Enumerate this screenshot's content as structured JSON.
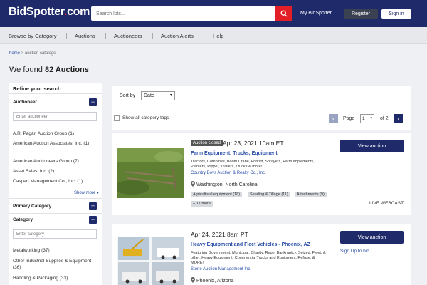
{
  "header": {
    "logo_main": "BidSpotter",
    "logo_dot": ".",
    "logo_tld": "com",
    "search_placeholder": "Search lots...",
    "my_account": "My BidSpotter",
    "register": "Register",
    "signin": "Sign in",
    "colors": {
      "brand": "#1f2a6b",
      "accent": "#e21f26"
    }
  },
  "nav": {
    "items": [
      "Browse by Category",
      "Auctions",
      "Auctioneers",
      "Auction Alerts",
      "Help"
    ]
  },
  "breadcrumb": {
    "home": "home",
    "sep": ">",
    "current": "auction catalogs"
  },
  "results": {
    "prefix": "We found",
    "count": "82 Auctions"
  },
  "sidebar": {
    "title": "Refine your search",
    "auctioneer": {
      "label": "Auctioneer",
      "toggle": "−",
      "placeholder": "Enter auctioneer",
      "items": [
        "A.R. Pagán Auction Group (1)",
        "American Auction Associates, Inc. (1)",
        "American Auctioneers Group (7)",
        "Asset Sales, Inc. (2)",
        "Caspert Management Co., Inc. (1)"
      ],
      "more": "Show more ▾"
    },
    "primary_category": {
      "label": "Primary Category",
      "toggle": "+"
    },
    "category": {
      "label": "Category",
      "toggle": "−",
      "placeholder": "Enter category",
      "items": [
        "Metalworking (37)",
        "Other Industrial Supplies & Equipment (36)",
        "Handling & Packaging (33)"
      ]
    }
  },
  "filters": {
    "sort_label": "Sort by",
    "sort_value": "Date",
    "show_all_tags": "Show all category tags",
    "page_label": "Page",
    "page_value": "1",
    "page_of": "of 2",
    "prev": "‹",
    "next": "›"
  },
  "auctions": [
    {
      "status": "Auction closed",
      "date": "Apr 23, 2021 10am ET",
      "title": "Farm Equipment, Trucks, Equipment",
      "description": "Tractors, Combines, Boom Crane, Forklift, Sprayers, Farm Implements, Planters, Ripper, Trailers, Trucks & more!",
      "auctioneer": "Country Boys Auction & Realty Co., Inc",
      "location": "Washington, North Carolina",
      "tags": [
        "Agricultural equipment (18)",
        "Seeding & Tillage (11)",
        "Attachments (9)",
        "+ 17 more"
      ],
      "button": "View auction",
      "footer": "LIVE WEBCAST"
    },
    {
      "status": "",
      "date": "Apr 24, 2021 8am PT",
      "title": "Heavy Equipment and Fleet Vehicles - Phoenix, AZ",
      "description": "Featuring Government, Municipal, Charity, Repo, Bankruptcy, Seized, Fleet, & other. Heavy Equipment, Commercial Trucks and Equipment, Refuse, & MORE!",
      "auctioneer": "Stone Auction Management Inc",
      "location": "Phoenix, Arizona",
      "tags": [],
      "button": "View auction",
      "footer": "Sign Up to bid"
    }
  ]
}
